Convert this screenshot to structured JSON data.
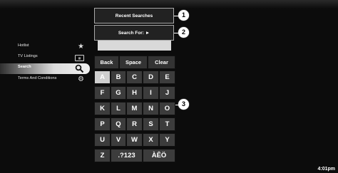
{
  "sidebar": {
    "items": [
      {
        "label": "Hotlist",
        "icon": "star-icon",
        "glyph": "★"
      },
      {
        "label": "TV Listings",
        "icon": "tv-guide-icon",
        "glyph": "▭"
      },
      {
        "label": "Search",
        "icon": "search-icon",
        "glyph": "⚲"
      },
      {
        "label": "Terms And Conditions",
        "icon": "settings-icon",
        "glyph": "⚙"
      }
    ]
  },
  "panel": {
    "recent_searches": "Recent Searches",
    "search_for": "Search For: ►",
    "search_value": ""
  },
  "keypad": {
    "controls": [
      "Back",
      "Space",
      "Clear"
    ],
    "rows": [
      [
        "A",
        "B",
        "C",
        "D",
        "E"
      ],
      [
        "F",
        "G",
        "H",
        "I",
        "J"
      ],
      [
        "K",
        "L",
        "M",
        "N",
        "O"
      ],
      [
        "P",
        "Q",
        "R",
        "S",
        "T"
      ],
      [
        "U",
        "V",
        "W",
        "X",
        "Y"
      ]
    ],
    "last_row": [
      "Z",
      ".?123",
      "ÀÊÖ"
    ],
    "selected": "A"
  },
  "callouts": [
    "1",
    "2",
    "3"
  ],
  "clock": "4:01pm"
}
